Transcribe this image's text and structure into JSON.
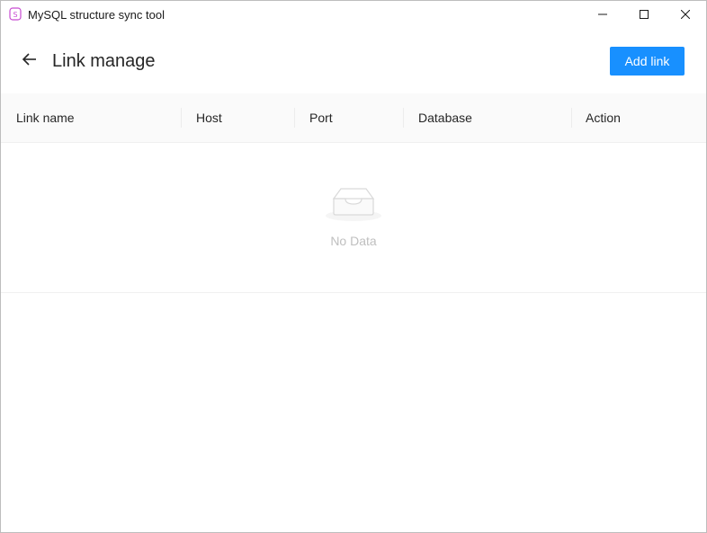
{
  "window": {
    "title": "MySQL structure sync tool",
    "app_icon": "database-s-icon",
    "controls": [
      "minimize-icon",
      "maximize-icon",
      "close-icon"
    ]
  },
  "header": {
    "title": "Link manage",
    "back_icon": "arrow-left-icon",
    "add_button_label": "Add link"
  },
  "table": {
    "columns": [
      "Link name",
      "Host",
      "Port",
      "Database",
      "Action"
    ],
    "rows": [],
    "empty_text": "No Data",
    "empty_icon": "empty-inbox-icon"
  },
  "colors": {
    "primary": "#1890ff",
    "header_bg": "#fafafa",
    "empty_text": "#bfbfbf",
    "app_icon": "#c74bd1"
  }
}
